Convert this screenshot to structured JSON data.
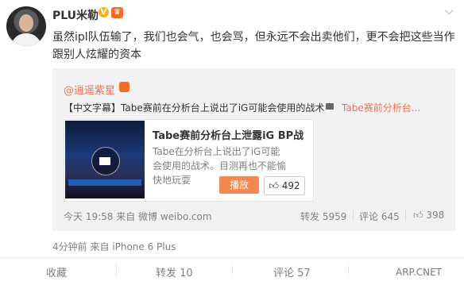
{
  "post": {
    "username": "PLU米勒",
    "verified_badge": "V",
    "text": "虽然ipl队伍输了，我们也会气，也会骂，但永远不会出卖他们，更不会把这些当作跟别人炫耀的资本",
    "meta": "4分钟前 来自 iPhone 6 Plus"
  },
  "repost": {
    "username": "@逍遥紫星",
    "text": "【中文字幕】Tabe赛前在分析台上说出了iG可能会使用的战术",
    "video_link": "Tabe赛前分析台...",
    "card": {
      "title": "Tabe赛前分析台上泄露iG BP战术 i...",
      "description": "Tabe在分析台上说出了iG可能会使用的战术。目测再也不能愉快地玩耍",
      "play_label": "播放",
      "like_count": "492"
    },
    "meta": "今天 19:58 来自 微博 weibo.com",
    "stats": {
      "repost": "转发 5959",
      "comment": "评论 645",
      "like": "398"
    }
  },
  "actions": {
    "favorite": "收藏",
    "repost": "转发 10",
    "comment": "评论 57"
  },
  "watermark": "ARP.CNET",
  "colors": {
    "accent": "#eb7350",
    "play_button": "#f08a52",
    "repost_bg": "#f2f2f5"
  }
}
